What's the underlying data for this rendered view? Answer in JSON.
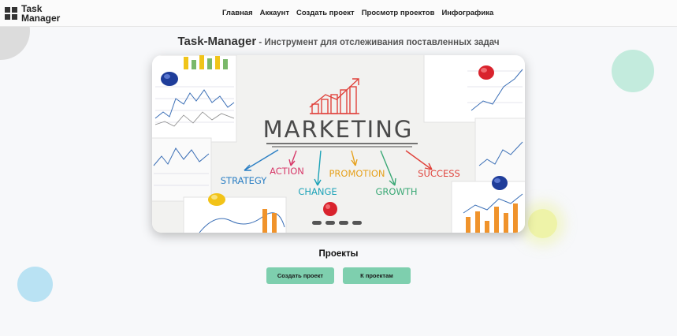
{
  "logo": {
    "text": "Task Manager"
  },
  "nav": [
    "Главная",
    "Аккаунт",
    "Создать проект",
    "Просмотр проектов",
    "Инфографика"
  ],
  "headline": {
    "title": "Task-Manager",
    "subtitle": " - Инструмент для отслеживания поставленных задач"
  },
  "hero": {
    "heading": "MARKETING",
    "words": [
      "STRATEGY",
      "ACTION",
      "CHANGE",
      "PROMOTION",
      "GROWTH",
      "SUCCESS"
    ],
    "colors": {
      "accent": "#e0433c",
      "dark": "#4a4a4a",
      "blue": "#2b7fc4",
      "green": "#3aa875",
      "gold": "#e6a21f",
      "pin_red": "#d9232d",
      "pin_blue": "#1f3d9a",
      "pin_yellow": "#f2c318"
    }
  },
  "projects": {
    "title": "Проекты",
    "create_label": "Создать проект",
    "list_label": "К проектам"
  },
  "colors": {
    "button": "#7ecfae",
    "blob_teal": "#bfe9dc",
    "blob_blue": "#b7e1f2",
    "blob_yellow": "#eef2a8"
  }
}
